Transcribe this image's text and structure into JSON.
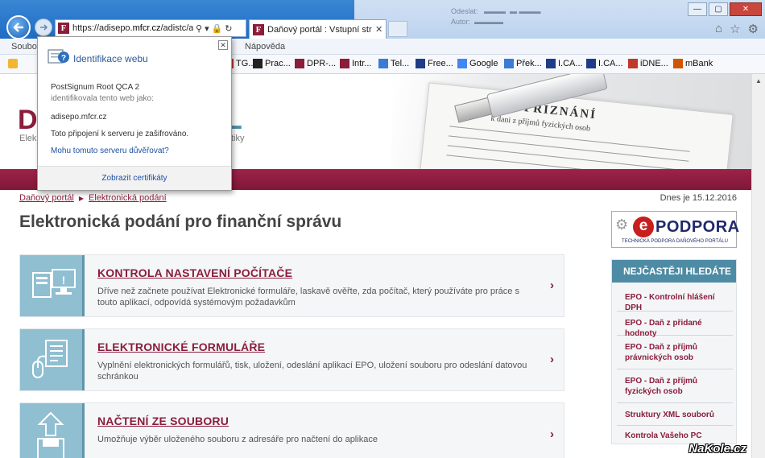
{
  "browser": {
    "url_prefix": "https://adisepo.",
    "url_domain": "mfcr.cz",
    "url_suffix": "/adistc/ad",
    "tab_title": "Daňový portál : Vstupní str...",
    "menu": [
      "Soubor",
      "Nápověda"
    ],
    "favorites": [
      {
        "label": "TG...",
        "icon_color": "#c0392b"
      },
      {
        "label": "Prac...",
        "icon_color": "#222222"
      },
      {
        "label": "DPR-...",
        "icon_color": "#8b1d3b"
      },
      {
        "label": "Intr...",
        "icon_color": "#8b1d3b"
      },
      {
        "label": "Tel...",
        "icon_color": "#3a7bd5"
      },
      {
        "label": "Free...",
        "icon_color": "#1f3c88"
      },
      {
        "label": "Google",
        "icon_color": "#4285f4"
      },
      {
        "label": "Přek...",
        "icon_color": "#3a7bd5"
      },
      {
        "label": "I.CA...",
        "icon_color": "#1f3c88"
      },
      {
        "label": "I.CA...",
        "icon_color": "#1f3c88"
      },
      {
        "label": "iDNE...",
        "icon_color": "#c0392b"
      },
      {
        "label": "mBank",
        "icon_color": "#d35400"
      }
    ]
  },
  "popup": {
    "title": "Identifikace webu",
    "issuer": "PostSignum Root QCA 2",
    "identified_text": "identifikovala tento web jako:",
    "domain": "adisepo.mfcr.cz",
    "encrypted": "Toto připojení k serveru je zašifrováno.",
    "trust_link": "Mohu tomuto serveru důvěřovat?",
    "footer": "Zobrazit certifikáty"
  },
  "page": {
    "logo_letter_left": "D",
    "logo_letter_right": "L",
    "logo_sub_left": "Elek",
    "logo_sub_right": "tiky",
    "hero_title": "PŘIZNÁNÍ",
    "hero_sub": "k dani z příjmů fyzických osob",
    "breadcrumb": [
      "Daňový portál",
      "Elektronická podání"
    ],
    "date": "Dnes je 15.12.2016",
    "title": "Elektronická podání pro finanční správu",
    "cards": [
      {
        "heading": "KONTROLA NASTAVENÍ POČÍTAČE",
        "description": "Dříve než začnete používat Elektronické formuláře, laskavě ověřte, zda počítač, který používáte pro práce s touto aplikací, odpovídá systémovým požadavkům",
        "icon": "computer-icon"
      },
      {
        "heading": "ELEKTRONICKÉ FORMULÁŘE",
        "description": "Vyplnění elektronických formulářů, tisk, uložení, odeslání aplikací EPO, uložení souboru pro odeslání datovou schránkou",
        "icon": "form-icon"
      },
      {
        "heading": "NAČTENÍ ZE SOUBORU",
        "description": "Umožňuje výběr uloženého souboru z adresáře pro načtení do aplikace",
        "icon": "upload-icon"
      }
    ],
    "epodpora": {
      "mark": "e",
      "word": "PODPORA",
      "sub": "TECHNICKÁ PODPORA DAŇOVÉHO PORTÁLU"
    },
    "faq": {
      "heading": "NEJČASTĚJI HLEDÁTE",
      "items": [
        "EPO - Kontrolní hlášení DPH",
        "EPO - Daň z přidané hodnoty",
        "EPO - Daň z příjmů právnických osob",
        "EPO - Daň z příjmů fyzických osob",
        "Struktury XML souborů",
        "Kontrola Vašeho PC"
      ]
    }
  },
  "watermark": "NaKole.cz"
}
